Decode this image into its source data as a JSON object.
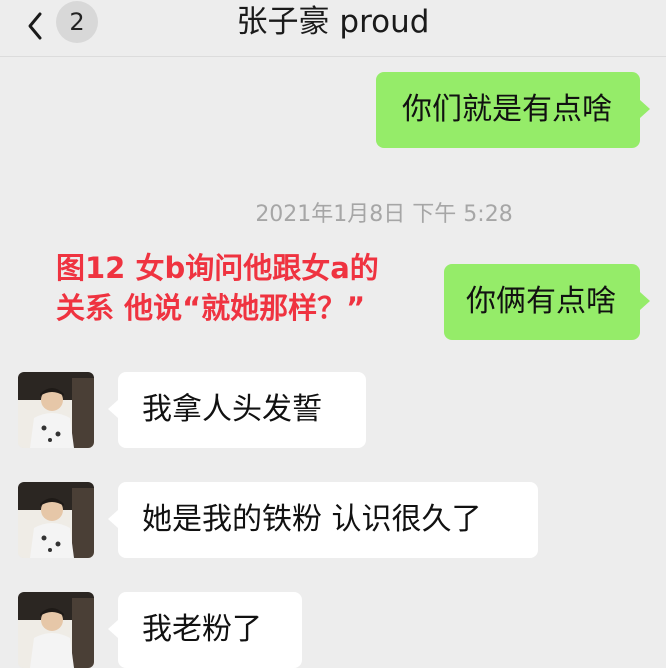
{
  "header": {
    "back_icon": "chevron-left-icon",
    "unread_count": "2",
    "title": "张子豪 proud"
  },
  "messages": [
    {
      "sender": "me",
      "text": "你们就是有点啥"
    },
    {
      "sender": "me",
      "text": "你俩有点啥"
    },
    {
      "sender": "other",
      "text": "我拿人头发誓"
    },
    {
      "sender": "other",
      "text": "她是我的铁粉 认识很久了"
    },
    {
      "sender": "other",
      "text": "我老粉了"
    }
  ],
  "timestamp": "2021年1月8日 下午 5:28",
  "caption": {
    "line1": "图12 女b询问他跟女a的",
    "line2": "关系 他说“就她那样？”",
    "color": "#ef3340"
  },
  "colors": {
    "bubble_me": "#95ec69",
    "bubble_other": "#ffffff",
    "background": "#ededed"
  }
}
